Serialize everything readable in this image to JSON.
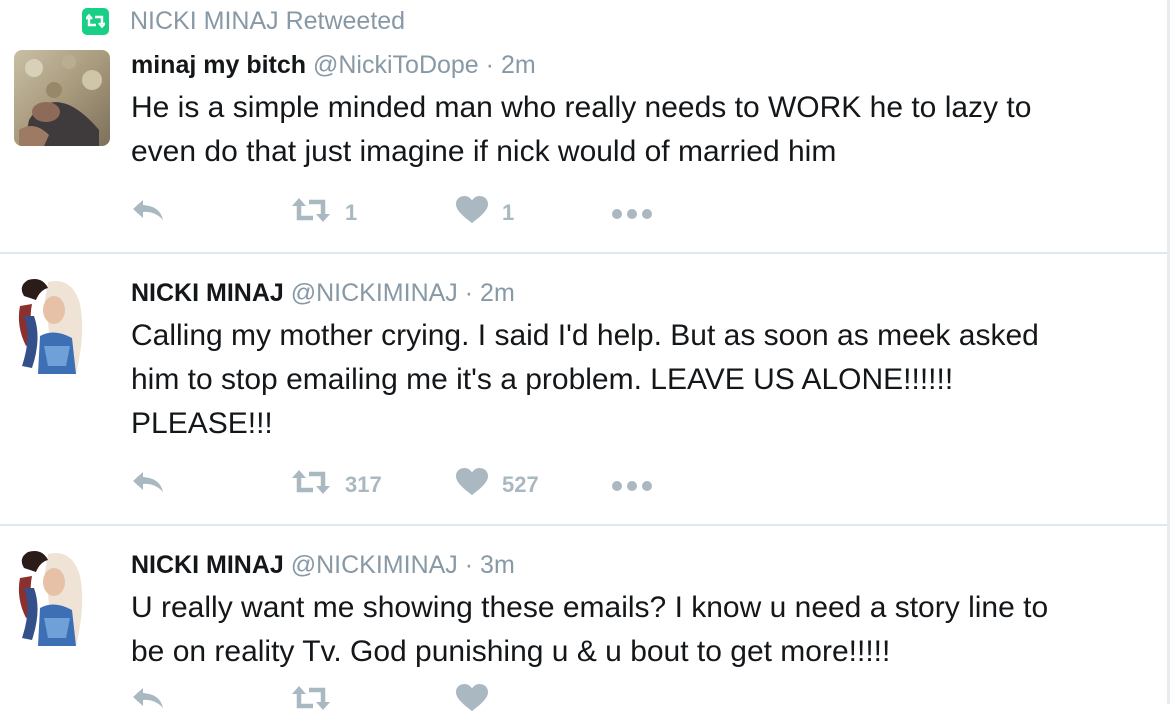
{
  "retweet_context": {
    "label": "NICKI MINAJ Retweeted",
    "icon": "retweet-icon",
    "color": "#19cf86"
  },
  "tweets": [
    {
      "name": "minaj my bitch",
      "handle": "@NickiToDope",
      "separator": "·",
      "time": "2m",
      "text": "He is a simple minded man who really needs to WORK he to lazy to\neven do that just imagine if nick would of married him",
      "retweets": "1",
      "likes": "1"
    },
    {
      "name": "NICKI MINAJ",
      "handle": "@NICKIMINAJ",
      "separator": "·",
      "time": "2m",
      "text": "Calling my mother crying. I said I'd help. But as soon as meek asked\nhim to stop emailing me it's a problem. LEAVE US ALONE!!!!!!\nPLEASE!!!",
      "retweets": "317",
      "likes": "527"
    },
    {
      "name": "NICKI MINAJ",
      "handle": "@NICKIMINAJ",
      "separator": "·",
      "time": "3m",
      "text": "U really want me showing these emails? I know u need a story line to\nbe on reality Tv. God punishing u & u bout to get more!!!!!",
      "retweets": "",
      "likes": ""
    }
  ],
  "colors": {
    "muted": "#8899a6",
    "action": "#aab8c2",
    "divider": "#e1e8ed"
  }
}
